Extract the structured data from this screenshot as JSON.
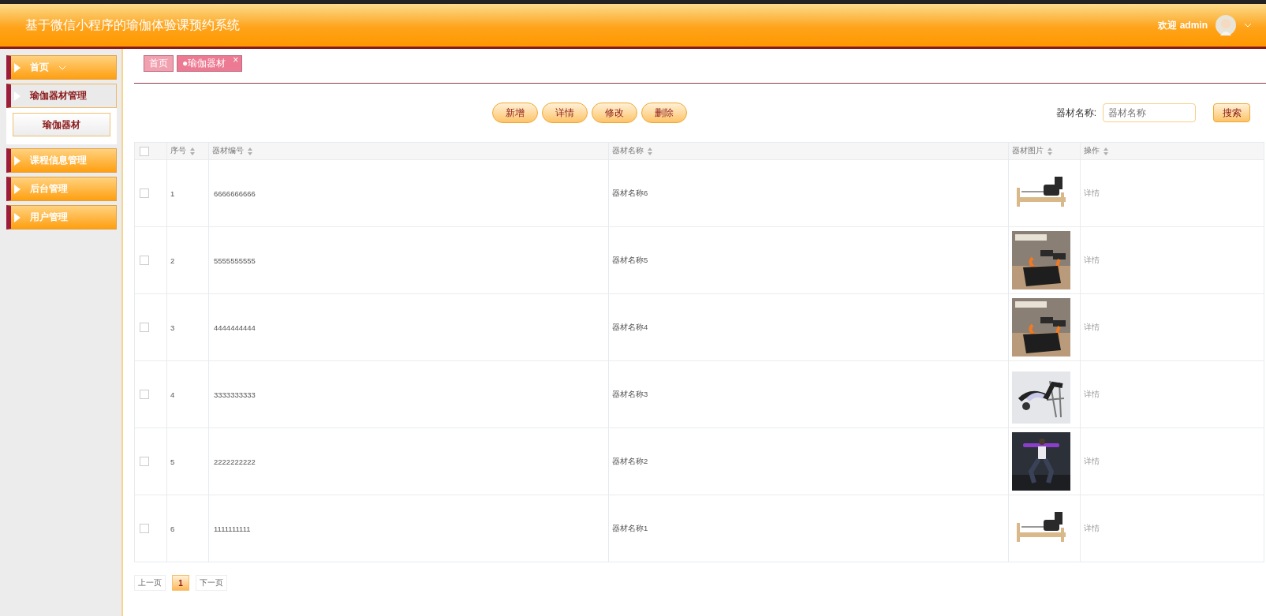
{
  "header": {
    "title": "基于微信小程序的瑜伽体验课预约系统",
    "welcome": "欢迎 admin"
  },
  "sidebar": {
    "items": [
      {
        "label": "首页",
        "kind": "link",
        "expanded": false
      },
      {
        "label": "瑜伽器材管理",
        "kind": "group",
        "expanded": true,
        "children": [
          {
            "label": "瑜伽器材"
          }
        ]
      },
      {
        "label": "课程信息管理",
        "kind": "group",
        "expanded": false
      },
      {
        "label": "后台管理",
        "kind": "group",
        "expanded": false
      },
      {
        "label": "用户管理",
        "kind": "group",
        "expanded": false
      }
    ]
  },
  "tabs": [
    {
      "label": "首页",
      "selected": false
    },
    {
      "label": "●瑜伽器材",
      "selected": true,
      "close": "×"
    }
  ],
  "actions": [
    "新增",
    "详情",
    "修改",
    "删除"
  ],
  "search": {
    "label": "器材名称:",
    "placeholder": "器材名称",
    "button": "搜索"
  },
  "table": {
    "all_checked": false,
    "columns": [
      "序号",
      "器材编号",
      "器材名称",
      "器材图片",
      "操作"
    ],
    "rows": [
      {
        "checked": false,
        "index": "1",
        "code": "6666666666",
        "name": "器材名称6",
        "action": "详情"
      },
      {
        "checked": false,
        "index": "2",
        "code": "5555555555",
        "name": "器材名称5",
        "action": "详情"
      },
      {
        "checked": false,
        "index": "3",
        "code": "4444444444",
        "name": "器材名称4",
        "action": "详情"
      },
      {
        "checked": false,
        "index": "4",
        "code": "3333333333",
        "name": "器材名称3",
        "action": "详情"
      },
      {
        "checked": false,
        "index": "5",
        "code": "2222222222",
        "name": "器材名称2",
        "action": "详情"
      },
      {
        "checked": false,
        "index": "6",
        "code": "1111111111",
        "name": "器材名称1",
        "action": "详情"
      }
    ]
  },
  "pagination": {
    "prev": "上一页",
    "pages": [
      {
        "label": "1",
        "selected": true
      }
    ],
    "next": "下一页"
  }
}
